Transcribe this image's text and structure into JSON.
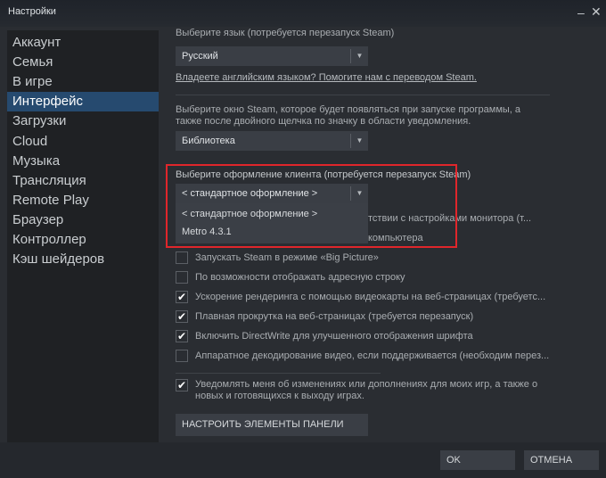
{
  "window": {
    "title": "Настройки",
    "minimize_icon": "minimize-icon",
    "close_icon": "close-icon"
  },
  "sidebar": {
    "items": [
      {
        "label": "Аккаунт"
      },
      {
        "label": "Семья"
      },
      {
        "label": "В игре"
      },
      {
        "label": "Интерфейс",
        "selected": true
      },
      {
        "label": "Загрузки"
      },
      {
        "label": "Cloud"
      },
      {
        "label": "Музыка"
      },
      {
        "label": "Трансляция"
      },
      {
        "label": "Remote Play"
      },
      {
        "label": "Браузер"
      },
      {
        "label": "Контроллер"
      },
      {
        "label": "Кэш шейдеров"
      }
    ]
  },
  "main": {
    "language_label": "Выберите язык (потребуется перезапуск Steam)",
    "language_value": "Русский",
    "translate_link": "Владеете английским языком? Помогите нам с переводом Steam.",
    "window_label_1": "Выберите окно Steam, которое будет появляться при запуске программы, а",
    "window_label_2": "также после двойного щелчка по значку в области уведомления.",
    "window_value": "Библиотека",
    "skin_label": "Выберите оформление клиента (потребуется перезапуск Steam)",
    "skin_value": "< стандартное оформление >",
    "skin_options": [
      "< стандартное оформление >",
      "Metro 4.3.1"
    ],
    "hidden_fragment_1": "тствии с настройками монитора (т...",
    "hidden_fragment_2": "компьютера",
    "checkboxes": [
      {
        "label": "Запускать Steam в режиме «Big Picture»",
        "checked": false
      },
      {
        "label": "По возможности отображать адресную строку",
        "checked": false
      },
      {
        "label": "Ускорение рендеринга с помощью видеокарты на веб-страницах (требуетс...",
        "checked": true
      },
      {
        "label": "Плавная прокрутка на веб-страницах (требуется перезапуск)",
        "checked": true
      },
      {
        "label": "Включить DirectWrite для улучшенного отображения шрифта",
        "checked": true
      },
      {
        "label": "Аппаратное декодирование видео, если поддерживается (необходим перез...",
        "checked": false
      }
    ],
    "notify_label_1": "Уведомлять меня об изменениях или дополнениях для моих игр, а также о",
    "notify_label_2": "новых и готовящихся к выходу играх.",
    "notify_checked": true,
    "taskbar_button": "НАСТРОИТЬ ЭЛЕМЕНТЫ ПАНЕЛИ ЗАДАЧ"
  },
  "footer": {
    "ok": "OK",
    "cancel": "ОТМЕНА"
  },
  "colors": {
    "highlight": "#e0262b",
    "selected": "#264a6f"
  }
}
